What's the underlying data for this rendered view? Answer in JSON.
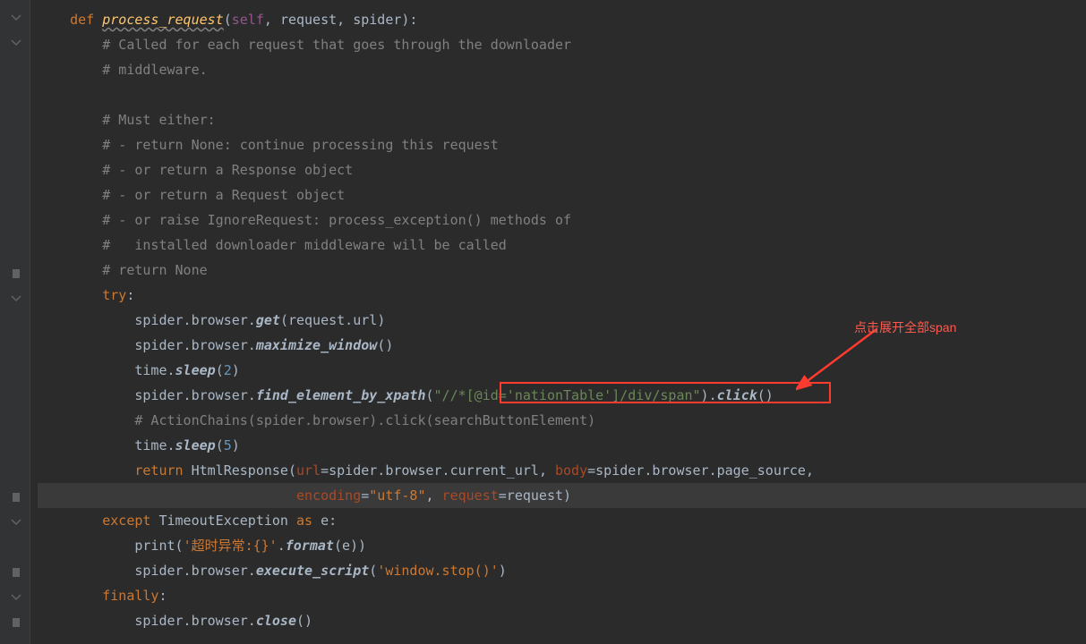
{
  "code": {
    "line1": {
      "kw_def": "def ",
      "fn_name": "process_request",
      "paren_open": "(",
      "self": "self",
      "comma1": ", ",
      "p_request": "request",
      "comma2": ", ",
      "p_spider": "spider",
      "paren_close": "):"
    },
    "line2": "# Called for each request that goes through the downloader",
    "line3": "# middleware.",
    "line5": "# Must either:",
    "line6": "# - return None: continue processing this request",
    "line7": "# - or return a Response object",
    "line8": "# - or return a Request object",
    "line9": "# - or raise IgnoreRequest: process_exception() methods of",
    "line10": "#   installed downloader middleware will be called",
    "line11": "# return None",
    "line12": {
      "kw_try": "try",
      "colon": ":"
    },
    "line13": {
      "ident": "spider.browser.",
      "method": "get",
      "open": "(",
      "arg": "request.url",
      "close": ")"
    },
    "line14": {
      "ident": "spider.browser.",
      "method": "maximize_window",
      "parens": "()"
    },
    "line15": {
      "ident": "time.",
      "method": "sleep",
      "open": "(",
      "num": "2",
      "close": ")"
    },
    "line16": {
      "ident": "spider.browser.",
      "method": "find_element_by_xpath",
      "open": "(",
      "str": "\"//*[@id='nationTable']/div/span\"",
      "close": ").",
      "method2": "click",
      "parens2": "()"
    },
    "line17": "# ActionChains(spider.browser).click(searchButtonElement)",
    "line18": {
      "ident": "time.",
      "method": "sleep",
      "open": "(",
      "num": "5",
      "close": ")"
    },
    "line19": {
      "kw_return": "return ",
      "cls": "HtmlResponse",
      "open": "(",
      "k1": "url",
      "eq1": "=",
      "v1": "spider.browser.current_url",
      "comma1": ", ",
      "k2": "body",
      "eq2": "=",
      "v2": "spider.browser.page_source",
      "comma2": ","
    },
    "line20": {
      "k3": "encoding",
      "eq3": "=",
      "v3": "\"utf-8\"",
      "comma3": ", ",
      "k4": "request",
      "eq4": "=",
      "v4": "request",
      "close": ")"
    },
    "line21": {
      "kw_except": "except ",
      "exc": "TimeoutException ",
      "kw_as": "as ",
      "var": "e",
      "colon": ":"
    },
    "line22": {
      "fn": "print",
      "open": "(",
      "str": "'超时异常:{}'",
      "dot": ".",
      "method": "format",
      "open2": "(",
      "arg": "e",
      "close": "))"
    },
    "line23": {
      "ident": "spider.browser.",
      "method": "execute_script",
      "open": "(",
      "str": "'window.stop()'",
      "close": ")"
    },
    "line24": {
      "kw_finally": "finally",
      "colon": ":"
    },
    "line25": {
      "ident": "spider.browser.",
      "method": "close",
      "parens": "()"
    }
  },
  "annotation": {
    "text": "点击展开全部span"
  }
}
